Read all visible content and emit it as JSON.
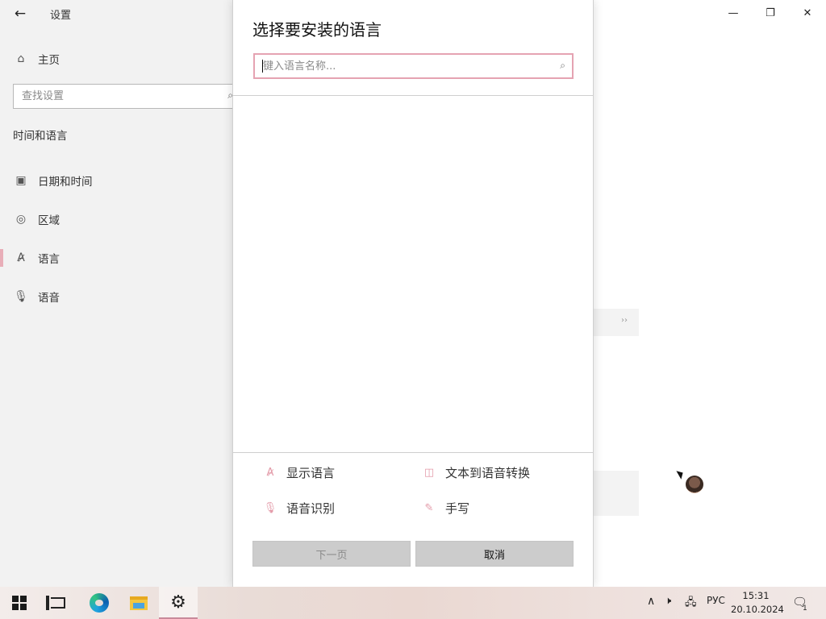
{
  "settings": {
    "title": "设置",
    "home_label": "主页",
    "search_placeholder": "查找设置",
    "section_heading": "时间和语言",
    "nav_items": [
      {
        "label": "日期和时间",
        "icon": "calendar-clock-icon"
      },
      {
        "label": "区域",
        "icon": "globe-icon"
      },
      {
        "label": "语言",
        "icon": "language-icon"
      },
      {
        "label": "语音",
        "icon": "microphone-icon"
      }
    ],
    "selected_item": "语言"
  },
  "window_controls": {
    "minimize": "minimize-icon",
    "restore": "restore-icon",
    "close": "close-icon"
  },
  "dialog": {
    "title": "选择要安装的语言",
    "search_placeholder": "键入语言名称...",
    "features": [
      {
        "label": "显示语言",
        "icon": "display-language-icon"
      },
      {
        "label": "文本到语音转换",
        "icon": "text-to-speech-icon"
      },
      {
        "label": "语音识别",
        "icon": "speech-recognition-icon"
      },
      {
        "label": "手写",
        "icon": "handwriting-icon"
      }
    ],
    "next_button": "下一页",
    "cancel_button": "取消"
  },
  "taskbar": {
    "keyboard_language": "РУС",
    "time": "15:31",
    "date": "20.10.2024",
    "notification_count": "1"
  },
  "colors": {
    "accent": "#e5a3b2",
    "sidebar_bg": "#f2f2f2",
    "button_bg": "#cccccc"
  }
}
